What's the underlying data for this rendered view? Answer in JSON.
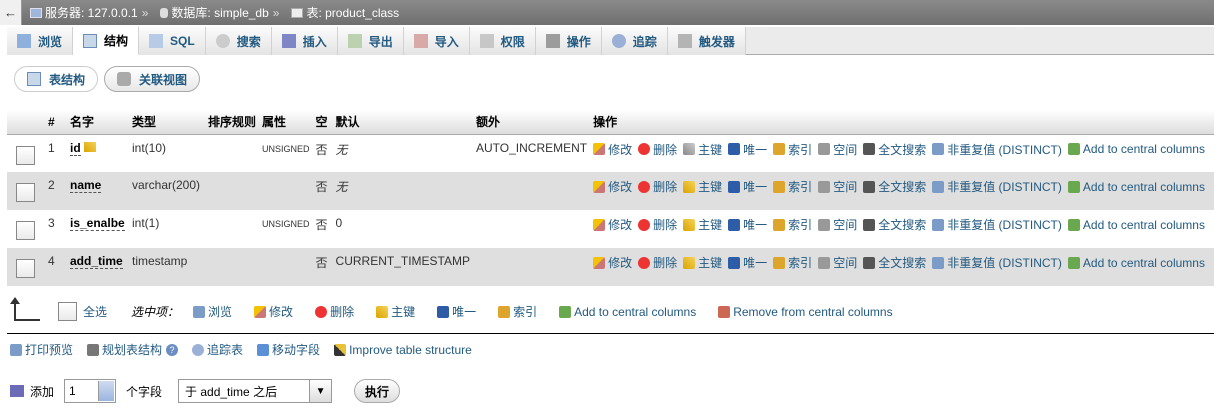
{
  "breadcrumb": {
    "server": "服务器: 127.0.0.1",
    "database": "数据库: simple_db",
    "table": "表: product_class",
    "separator": "»"
  },
  "tabs": [
    {
      "label": "浏览",
      "icon": "browse-icon"
    },
    {
      "label": "结构",
      "icon": "structure-icon",
      "active": true
    },
    {
      "label": "SQL",
      "icon": "sql-icon"
    },
    {
      "label": "搜索",
      "icon": "search-icon"
    },
    {
      "label": "插入",
      "icon": "insert-icon"
    },
    {
      "label": "导出",
      "icon": "export-icon"
    },
    {
      "label": "导入",
      "icon": "import-icon"
    },
    {
      "label": "权限",
      "icon": "privileges-icon"
    },
    {
      "label": "操作",
      "icon": "operations-icon"
    },
    {
      "label": "追踪",
      "icon": "tracking-icon"
    },
    {
      "label": "触发器",
      "icon": "triggers-icon"
    }
  ],
  "subtabs": [
    {
      "label": "表结构",
      "active": true
    },
    {
      "label": "关联视图"
    }
  ],
  "table": {
    "headers": [
      "#",
      "名字",
      "类型",
      "排序规则",
      "属性",
      "空",
      "默认",
      "额外",
      "操作"
    ],
    "rows": [
      {
        "num": "1",
        "name": "id",
        "type": "int(10)",
        "collation": "",
        "attr": "UNSIGNED",
        "null": "否",
        "default": "无",
        "extra": "AUTO_INCREMENT",
        "primary": true
      },
      {
        "num": "2",
        "name": "name",
        "type": "varchar(200)",
        "collation": "",
        "attr": "",
        "null": "否",
        "default": "无",
        "extra": ""
      },
      {
        "num": "3",
        "name": "is_enalbe",
        "type": "int(1)",
        "collation": "",
        "attr": "UNSIGNED",
        "null": "否",
        "default": "0",
        "extra": ""
      },
      {
        "num": "4",
        "name": "add_time",
        "type": "timestamp",
        "collation": "",
        "attr": "",
        "null": "否",
        "default": "CURRENT_TIMESTAMP",
        "extra": ""
      }
    ],
    "row_actions": {
      "edit": "修改",
      "delete": "删除",
      "primary": "主键",
      "unique": "唯一",
      "index": "索引",
      "spatial": "空间",
      "fulltext": "全文搜索",
      "distinct": "非重复值 (DISTINCT)",
      "central": "Add to central columns"
    }
  },
  "selection": {
    "check_all": "全选",
    "with_selected": "选中项：",
    "actions": {
      "browse": "浏览",
      "edit": "修改",
      "delete": "删除",
      "primary": "主键",
      "unique": "唯一",
      "index": "索引",
      "add_central": "Add to central columns",
      "remove_central": "Remove from central columns"
    }
  },
  "links": {
    "print": "打印预览",
    "plan": "规划表结构",
    "track": "追踪表",
    "move": "移动字段",
    "improve": "Improve table structure"
  },
  "add_field": {
    "label": "添加",
    "count": "1",
    "unit": "个字段",
    "position": "于 add_time 之后",
    "go": "执行"
  }
}
